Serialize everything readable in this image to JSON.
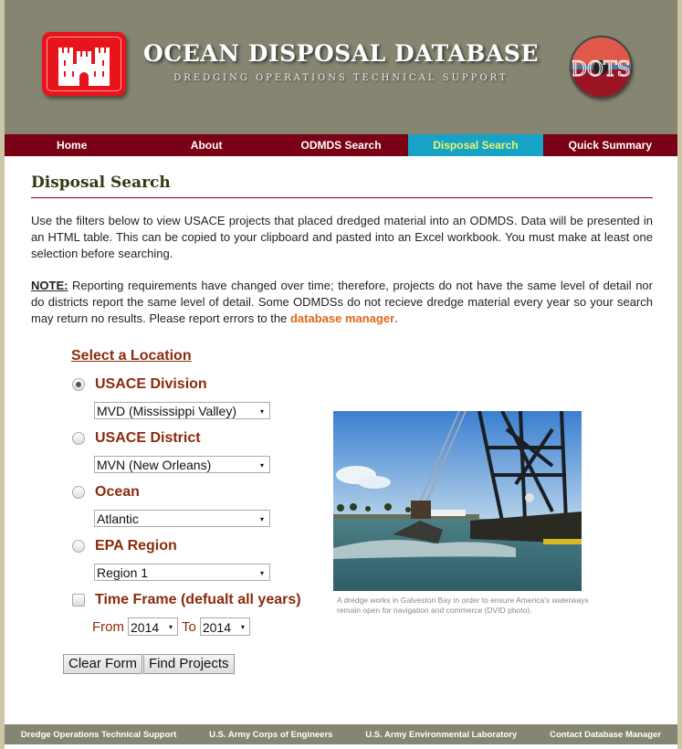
{
  "header": {
    "title": "OCEAN DISPOSAL DATABASE",
    "subtitle": "DREDGING OPERATIONS TECHNICAL SUPPORT",
    "left_logo": "usace-castle-logo",
    "right_logo": "dots-logo",
    "right_logo_text": "DOTS"
  },
  "nav": {
    "items": [
      {
        "label": "Home"
      },
      {
        "label": "About"
      },
      {
        "label": "ODMDS Search"
      },
      {
        "label": "Disposal Search",
        "active": true
      },
      {
        "label": "Quick Summary"
      }
    ]
  },
  "page": {
    "title": "Disposal Search",
    "intro": "Use the filters below to view USACE projects that placed dredged material into an ODMDS. Data will be presented in an HTML table. This can be copied to your clipboard and pasted into an Excel workbook. You must make at least one selection before searching.",
    "note_label": "NOTE:",
    "note_text": " Reporting requirements have changed over time; therefore, projects do not have the same level of detail nor do districts report the same level of detail. Some ODMDSs do not recieve dredge material every year so your search may return no results. Please report errors to the ",
    "note_link": "database manager",
    "note_end": "."
  },
  "form": {
    "section_title": "Select a Location",
    "options": [
      {
        "label": "USACE Division",
        "selected": true,
        "value": "MVD (Mississippi Valley)"
      },
      {
        "label": "USACE District",
        "selected": false,
        "value": "MVN (New Orleans)"
      },
      {
        "label": "Ocean",
        "selected": false,
        "value": "Atlantic"
      },
      {
        "label": "EPA Region",
        "selected": false,
        "value": "Region 1"
      }
    ],
    "time_frame": {
      "label": "Time Frame (defualt all years)",
      "checked": false,
      "from_label": "From",
      "from_value": "2014",
      "to_label": "To",
      "to_value": "2014"
    },
    "clear_button": "Clear Form",
    "find_button": "Find Projects",
    "caret": "▾"
  },
  "photo": {
    "caption": "A dredge works in Galveston Bay in order to ensure America's waterways remain open for navigation and commerce (DVID photo)."
  },
  "footer": {
    "links": [
      {
        "label": "Dredge Operations Technical Support"
      },
      {
        "label": "U.S. Army Corps of Engineers"
      },
      {
        "label": "U.S. Army Environmental Laboratory"
      },
      {
        "label": "Contact Database Manager"
      }
    ]
  },
  "colors": {
    "header_bg": "#858571",
    "nav_bg": "#7a0016",
    "nav_active_bg": "#17a3c8",
    "nav_active_text": "#e9f56a",
    "label_color": "#8b2b0e",
    "link_color": "#e0661a"
  }
}
